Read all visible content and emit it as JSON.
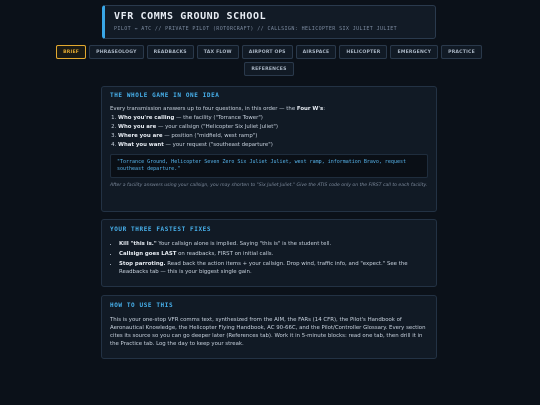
{
  "header": {
    "title": "VFR COMMS GROUND SCHOOL",
    "subtitle": "PILOT ↔ ATC // PRIVATE PILOT (ROTORCRAFT) // CALLSIGN: HELICOPTER SIX JULIET JULIET"
  },
  "tabs": {
    "row1": [
      "BRIEF",
      "PHRASEOLOGY",
      "READBACKS",
      "TAX FLOW",
      "AIRPORT OPS",
      "AIRSPACE",
      "HELICOPTER",
      "EMERGENCY",
      "PRACTICE"
    ],
    "row2": [
      "REFERENCES"
    ],
    "active": "BRIEF"
  },
  "idea": {
    "heading": "THE WHOLE GAME IN ONE IDEA",
    "intro_pre": "Every transmission answers up to four questions, in this order — the ",
    "intro_bold": "Four W's",
    "intro_post": ":",
    "items": [
      {
        "bold": "Who you're calling",
        "rest": " — the facility (\"Torrance Tower\")"
      },
      {
        "bold": "Who you are",
        "rest": " — your callsign (\"Helicopter Six Juliet Juliet\")"
      },
      {
        "bold": "Where you are",
        "rest": " — position (\"midfield, west ramp\")"
      },
      {
        "bold": "What you want",
        "rest": " — your request (\"southeast departure\")"
      }
    ],
    "example": "\"Torrance Ground, Helicopter Seven Zero Six Juliet Juliet, west ramp, information Bravo, request southeast departure.\"",
    "note": "After a facility answers using your callsign, you may shorten to \"Six Juliet Juliet.\" Give the ATIS code only on the FIRST call to each facility."
  },
  "fixes": {
    "heading": "YOUR THREE FASTEST FIXES",
    "items": [
      {
        "bold": "Kill \"this is.\"",
        "rest": " Your callsign alone is implied. Saying \"this is\" is the student tell."
      },
      {
        "bold": "Callsign goes LAST",
        "rest": " on readbacks, FIRST on initial calls."
      },
      {
        "bold": "Stop parroting.",
        "rest": " Read back the action items + your callsign. Drop wind, traffic info, and \"expect.\" See the Readbacks tab — this is your biggest single gain."
      }
    ]
  },
  "howto": {
    "heading": "HOW TO USE THIS",
    "body": "This is your one-stop VFR comms text, synthesized from the AIM, the FARs (14 CFR), the Pilot's Handbook of Aeronautical Knowledge, the Helicopter Flying Handbook, AC 90-66C, and the Pilot/Controller Glossary. Every section cites its source so you can go deeper later (References tab). Work it in 5-minute blocks: read one tab, then drill it in the Practice tab. Log the day to keep your streak."
  },
  "colors": {
    "accent": "#48b2ee",
    "active_tab": "#e3a92f",
    "background": "#0b1119",
    "card": "#111a25"
  }
}
